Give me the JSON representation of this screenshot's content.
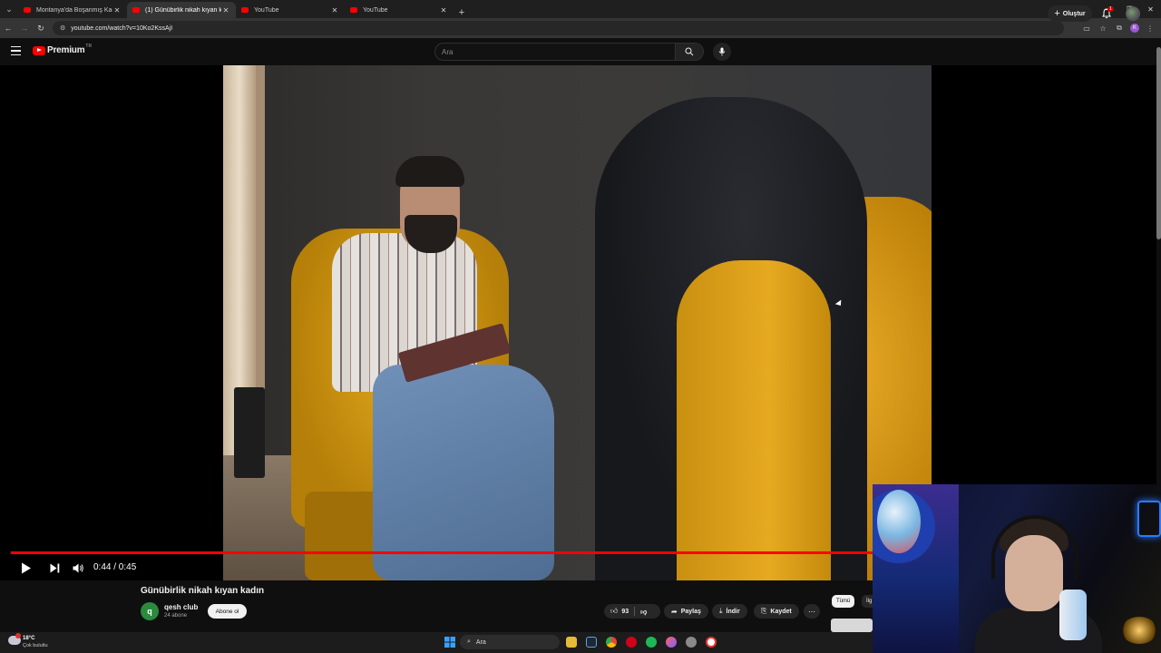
{
  "browser": {
    "tabs": [
      {
        "title": "Montanya'da Boşanmış Kadınlı",
        "active": false
      },
      {
        "title": "(1) Günübirlik nikah kıyan kadı",
        "active": true
      },
      {
        "title": "YouTube",
        "active": false
      },
      {
        "title": "YouTube",
        "active": false
      }
    ],
    "url": "youtube.com/watch?v=10Ko2KssAjI",
    "profile_letter": "K"
  },
  "header": {
    "brand": "Premium",
    "region": "TR",
    "search_placeholder": "Ara",
    "create_label": "Oluştur",
    "notification_count": "1"
  },
  "player": {
    "current_time": "0:44",
    "duration": "0:45",
    "time_label": "0:44 / 0:45",
    "progress": 0.978
  },
  "video": {
    "title": "Günübirlik nikah kıyan kadın",
    "channel_initial": "q",
    "channel_name": "qesh club",
    "subscribers": "24 abone",
    "subscribe_label": "Abone ol",
    "likes": "93",
    "share_label": "Paylaş",
    "download_label": "İndir",
    "save_label": "Kaydet"
  },
  "side_chips": [
    "Tümü",
    "İlg"
  ],
  "taskbar": {
    "temperature": "18°C",
    "weather": "Çok bulutlu",
    "search_placeholder": "Ara"
  },
  "colors": {
    "accent": "#ff0000",
    "background": "#0f0f0f",
    "pill": "#272727"
  }
}
